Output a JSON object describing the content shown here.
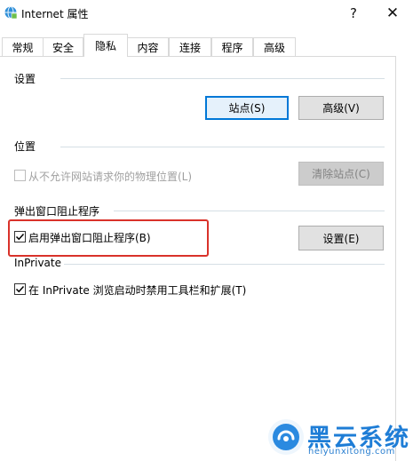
{
  "window": {
    "title": "Internet 属性",
    "help_label": "?",
    "close_label": "✕"
  },
  "tabs": [
    {
      "label": "常规"
    },
    {
      "label": "安全"
    },
    {
      "label": "隐私",
      "active": true
    },
    {
      "label": "内容"
    },
    {
      "label": "连接"
    },
    {
      "label": "程序"
    },
    {
      "label": "高级"
    }
  ],
  "settings": {
    "header": "设置",
    "sites_button": "站点(S)",
    "advanced_button": "高级(V)"
  },
  "location": {
    "header": "位置",
    "checkbox_label": "从不允许网站请求你的物理位置(L)",
    "checked": false,
    "clear_sites_button": "清除站点(C)"
  },
  "popup_blocker": {
    "header": "弹出窗口阻止程序",
    "checkbox_label": "启用弹出窗口阻止程序(B)",
    "checked": true,
    "settings_button": "设置(E)"
  },
  "inprivate": {
    "header": "InPrivate",
    "checkbox_label": "在 InPrivate 浏览启动时禁用工具栏和扩展(T)",
    "checked": true
  },
  "watermark": {
    "title": "黑云系统",
    "url": "heiyunxitong.com"
  },
  "colors": {
    "accent": "#0078d7",
    "highlight": "#d9322a",
    "watermark": "#1e7dd6"
  }
}
